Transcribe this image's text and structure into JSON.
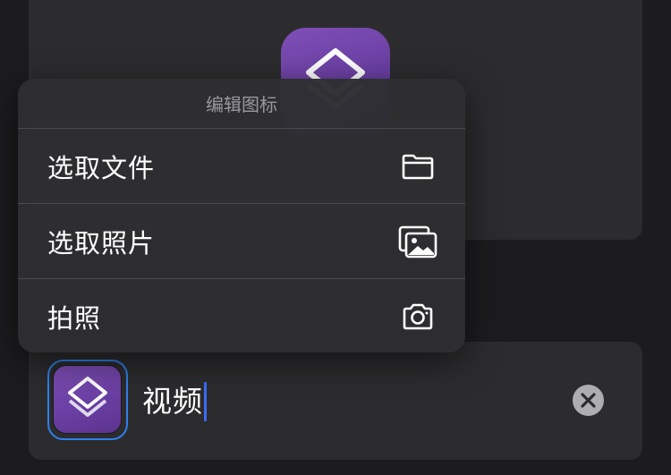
{
  "menu": {
    "title": "编辑图标",
    "items": [
      {
        "label": "选取文件",
        "icon": "folder-icon"
      },
      {
        "label": "选取照片",
        "icon": "photos-icon"
      },
      {
        "label": "拍照",
        "icon": "camera-icon"
      }
    ]
  },
  "name_field": {
    "value": "视频",
    "clear_icon": "clear-icon"
  },
  "preview": {
    "icon": "shortcuts-icon"
  },
  "colors": {
    "accent": "#2f80ed",
    "icon_background": "#6a3fa3",
    "caret": "#3a6cf6"
  }
}
